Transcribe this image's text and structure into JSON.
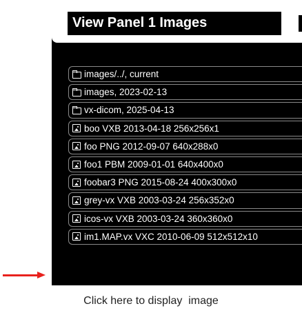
{
  "panel": {
    "title": "View Panel 1 Images"
  },
  "files": [
    {
      "icon": "folder-icon",
      "label": "images/../, current"
    },
    {
      "icon": "folder-icon",
      "label": "images, 2023-02-13"
    },
    {
      "icon": "folder-icon",
      "label": "vx-dicom, 2025-04-13"
    },
    {
      "icon": "image-icon",
      "label": "boo VXB 2013-04-18 256x256x1"
    },
    {
      "icon": "image-icon",
      "label": "foo PNG 2012-09-07 640x288x0"
    },
    {
      "icon": "image-icon",
      "label": "foo1 PBM 2009-01-01 640x400x0"
    },
    {
      "icon": "image-icon",
      "label": "foobar3 PNG 2015-08-24 400x300x0"
    },
    {
      "icon": "image-icon",
      "label": "grey-vx VXB 2003-03-24 256x352x0"
    },
    {
      "icon": "image-icon",
      "label": "icos-vx VXB 2003-03-24 360x360x0"
    },
    {
      "icon": "image-icon",
      "label": "im1.MAP.vx VXC 2010-06-09 512x512x10"
    }
  ],
  "annotation": {
    "caption": "Click here to display  image",
    "arrow_color": "#e8211d"
  },
  "colors": {
    "panel_bg": "#000000",
    "row_border": "#8a8a8a",
    "text": "#ffffff"
  }
}
